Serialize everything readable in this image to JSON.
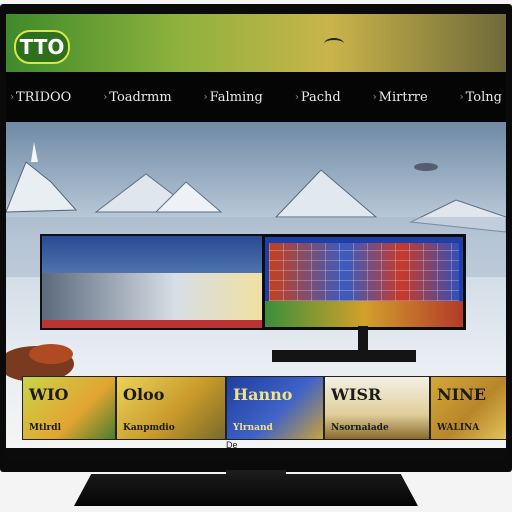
{
  "brand": {
    "logo_text": "TTO"
  },
  "nav": {
    "items": [
      {
        "label": "TRIDOO",
        "icon": "chevron-right-icon"
      },
      {
        "label": "Toadrmm",
        "icon": "chevron-right-icon"
      },
      {
        "label": "Falming",
        "icon": "chevron-right-icon"
      },
      {
        "label": "Pachd",
        "icon": "chevron-right-icon"
      },
      {
        "label": "Mirtrre",
        "icon": "chevron-right-icon"
      },
      {
        "label": "Tolng",
        "icon": "chevron-right-icon"
      }
    ],
    "nav_icon_glyph": "›"
  },
  "shelf": {
    "tiles": [
      {
        "title": "WIO",
        "subtitle": "Mtlrdl"
      },
      {
        "title": "Oloo",
        "subtitle": "Kanpmdio"
      },
      {
        "title": "Hanno",
        "subtitle": "Ylrnand"
      },
      {
        "title": "WISR",
        "subtitle": "Nsornaiade"
      },
      {
        "title": "NINE",
        "subtitle": "WALINA"
      }
    ],
    "caption": "De"
  },
  "colors": {
    "accent_green": "#3f8a2a",
    "nav_bg": "#050505",
    "tv_frame": "#0a0a0a"
  }
}
